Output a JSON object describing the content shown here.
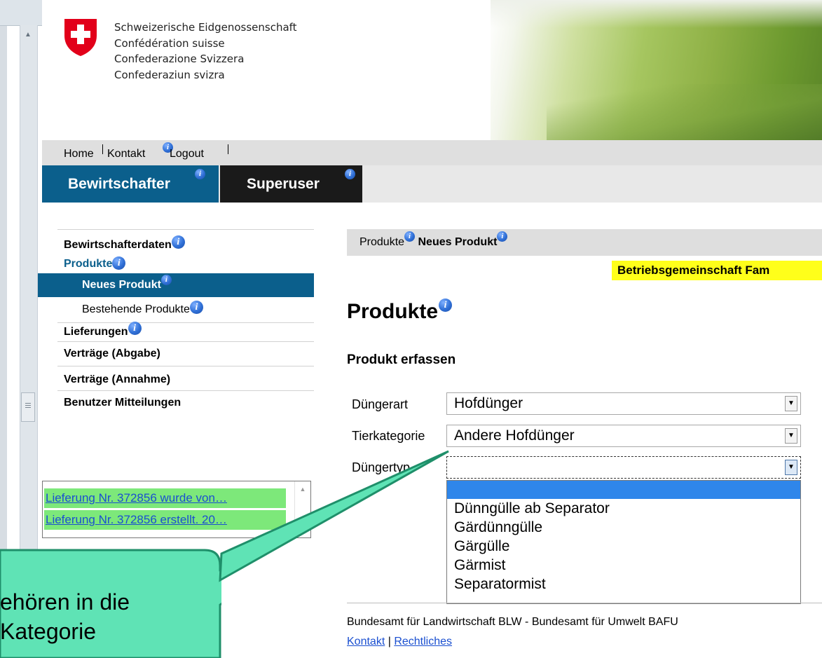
{
  "header": {
    "confederation_lines": [
      "Schweizerische Eidgenossenschaft",
      "Confédération suisse",
      "Confederazione Svizzera",
      "Confederaziun svizra"
    ]
  },
  "meta_nav": {
    "home": "Home",
    "contact": "Kontakt",
    "logout": "Logout"
  },
  "tabs": [
    {
      "label": "Bewirtschafter",
      "active": true
    },
    {
      "label": "Superuser",
      "active": false
    }
  ],
  "sidebar": {
    "items": [
      {
        "label": "Bewirtschafterdaten"
      },
      {
        "label": "Produkte"
      },
      {
        "label": "Neues Produkt"
      },
      {
        "label": "Bestehende Produkte"
      },
      {
        "label": "Lieferungen"
      },
      {
        "label": "Verträge (Abgabe)"
      },
      {
        "label": "Verträge (Annahme)"
      },
      {
        "label": "Benutzer Mitteilungen"
      }
    ]
  },
  "notifications": [
    "Lieferung Nr. 372856 wurde von…",
    "Lieferung Nr. 372856 erstellt. 20…"
  ],
  "breadcrumb": {
    "parent": "Produkte",
    "current": "Neues Produkt"
  },
  "banner": "Betriebsgemeinschaft Fam",
  "main": {
    "title": "Produkte",
    "subtitle": "Produkt erfassen"
  },
  "form": {
    "fields": [
      {
        "label": "Düngerart",
        "value": "Hofdünger"
      },
      {
        "label": "Tierkategorie",
        "value": "Andere Hofdünger"
      },
      {
        "label": "Düngertyp",
        "value": ""
      }
    ],
    "dropdown_options": [
      "",
      "Dünngülle ab Separator",
      "Gärdünngülle",
      "Gärgülle",
      "Gärmist",
      "Separatormist"
    ]
  },
  "callout": {
    "line1": "ehören in die",
    "line2": " Kategorie"
  },
  "footer": {
    "text": "Bundesamt für Landwirtschaft BLW - Bundesamt für Umwelt BAFU",
    "link_contact": "Kontakt",
    "separator": "|",
    "link_legal": "Rechtliches"
  },
  "icons": {
    "info": "info-icon",
    "logo": "swiss-cross-shield-icon"
  },
  "colors": {
    "tab_active": "#0b5f8c",
    "tab_inactive": "#1a1a1a",
    "banner": "#ffff1a",
    "dropdown_highlight": "#2f86ea",
    "notification_bg": "#7de87a",
    "callout": "#5fe3b5"
  }
}
